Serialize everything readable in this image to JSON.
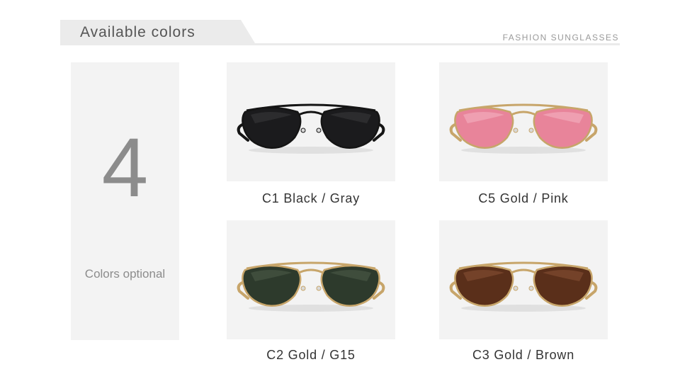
{
  "header": {
    "title": "Available colors",
    "subtitle": "FASHION SUNGLASSES"
  },
  "info": {
    "count": "4",
    "label": "Colors optional"
  },
  "products": [
    {
      "caption": "C1 Black / Gray",
      "frame_color": "#151515",
      "lens_color": "#1b1b1d",
      "lens_highlight": "#3a3a3c",
      "icon": "sunglasses-black-icon"
    },
    {
      "caption": "C5 Gold / Pink",
      "frame_color": "#c7a56a",
      "lens_color": "#e8849a",
      "lens_highlight": "#f4b6c4",
      "icon": "sunglasses-pink-icon"
    },
    {
      "caption": "C2 Gold / G15",
      "frame_color": "#c7a56a",
      "lens_color": "#2d3a2c",
      "lens_highlight": "#4e5c4b",
      "icon": "sunglasses-green-icon"
    },
    {
      "caption": "C3 Gold / Brown",
      "frame_color": "#c7a56a",
      "lens_color": "#5a2f1a",
      "lens_highlight": "#8a5236",
      "icon": "sunglasses-brown-icon"
    }
  ]
}
